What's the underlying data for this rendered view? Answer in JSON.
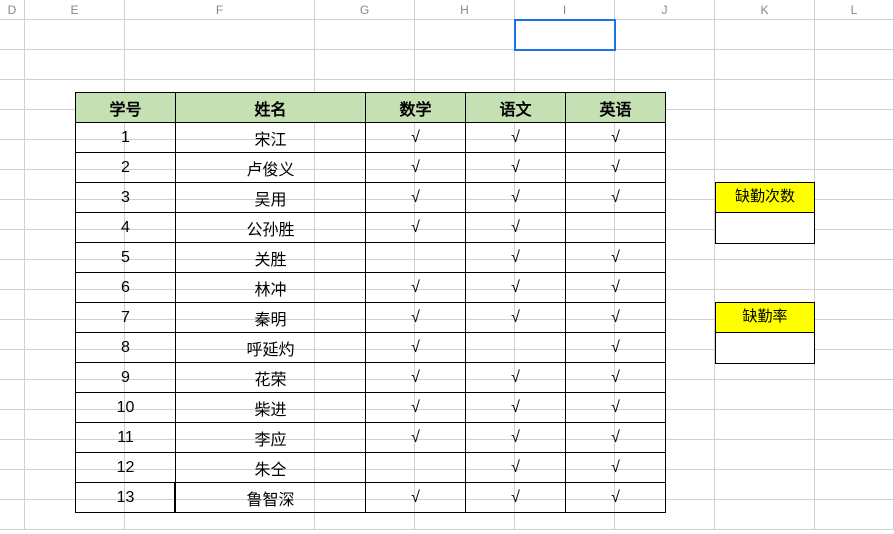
{
  "columns": [
    "D",
    "E",
    "F",
    "G",
    "H",
    "I",
    "J",
    "K",
    "L"
  ],
  "headers": {
    "id": "学号",
    "name": "姓名",
    "math": "数学",
    "chinese": "语文",
    "english": "英语"
  },
  "check": "√",
  "rows": [
    {
      "id": "1",
      "name": "宋江",
      "math": true,
      "chinese": true,
      "english": true
    },
    {
      "id": "2",
      "name": "卢俊义",
      "math": true,
      "chinese": true,
      "english": true
    },
    {
      "id": "3",
      "name": "吴用",
      "math": true,
      "chinese": true,
      "english": true
    },
    {
      "id": "4",
      "name": "公孙胜",
      "math": true,
      "chinese": true,
      "english": false
    },
    {
      "id": "5",
      "name": "关胜",
      "math": false,
      "chinese": true,
      "english": true
    },
    {
      "id": "6",
      "name": "林冲",
      "math": true,
      "chinese": true,
      "english": true
    },
    {
      "id": "7",
      "name": "秦明",
      "math": true,
      "chinese": true,
      "english": true
    },
    {
      "id": "8",
      "name": "呼延灼",
      "math": true,
      "chinese": false,
      "english": true
    },
    {
      "id": "9",
      "name": "花荣",
      "math": true,
      "chinese": true,
      "english": true
    },
    {
      "id": "10",
      "name": "柴进",
      "math": true,
      "chinese": true,
      "english": true
    },
    {
      "id": "11",
      "name": "李应",
      "math": true,
      "chinese": true,
      "english": true
    },
    {
      "id": "12",
      "name": "朱仝",
      "math": false,
      "chinese": true,
      "english": true
    },
    {
      "id": "13",
      "name": "鲁智深",
      "math": true,
      "chinese": true,
      "english": true
    }
  ],
  "side": {
    "absence_count_label": "缺勤次数",
    "absence_count_value": "",
    "absence_rate_label": "缺勤率",
    "absence_rate_value": ""
  },
  "chart_data": {
    "type": "table",
    "title": "",
    "columns": [
      "学号",
      "姓名",
      "数学",
      "语文",
      "英语"
    ],
    "data": [
      [
        1,
        "宋江",
        "√",
        "√",
        "√"
      ],
      [
        2,
        "卢俊义",
        "√",
        "√",
        "√"
      ],
      [
        3,
        "吴用",
        "√",
        "√",
        "√"
      ],
      [
        4,
        "公孙胜",
        "√",
        "√",
        ""
      ],
      [
        5,
        "关胜",
        "",
        "√",
        "√"
      ],
      [
        6,
        "林冲",
        "√",
        "√",
        "√"
      ],
      [
        7,
        "秦明",
        "√",
        "√",
        "√"
      ],
      [
        8,
        "呼延灼",
        "√",
        "",
        "√"
      ],
      [
        9,
        "花荣",
        "√",
        "√",
        "√"
      ],
      [
        10,
        "柴进",
        "√",
        "√",
        "√"
      ],
      [
        11,
        "李应",
        "√",
        "√",
        "√"
      ],
      [
        12,
        "朱仝",
        "",
        "√",
        "√"
      ],
      [
        13,
        "鲁智深",
        "√",
        "√",
        "√"
      ]
    ],
    "side_summary": {
      "缺勤次数": "",
      "缺勤率": ""
    }
  }
}
